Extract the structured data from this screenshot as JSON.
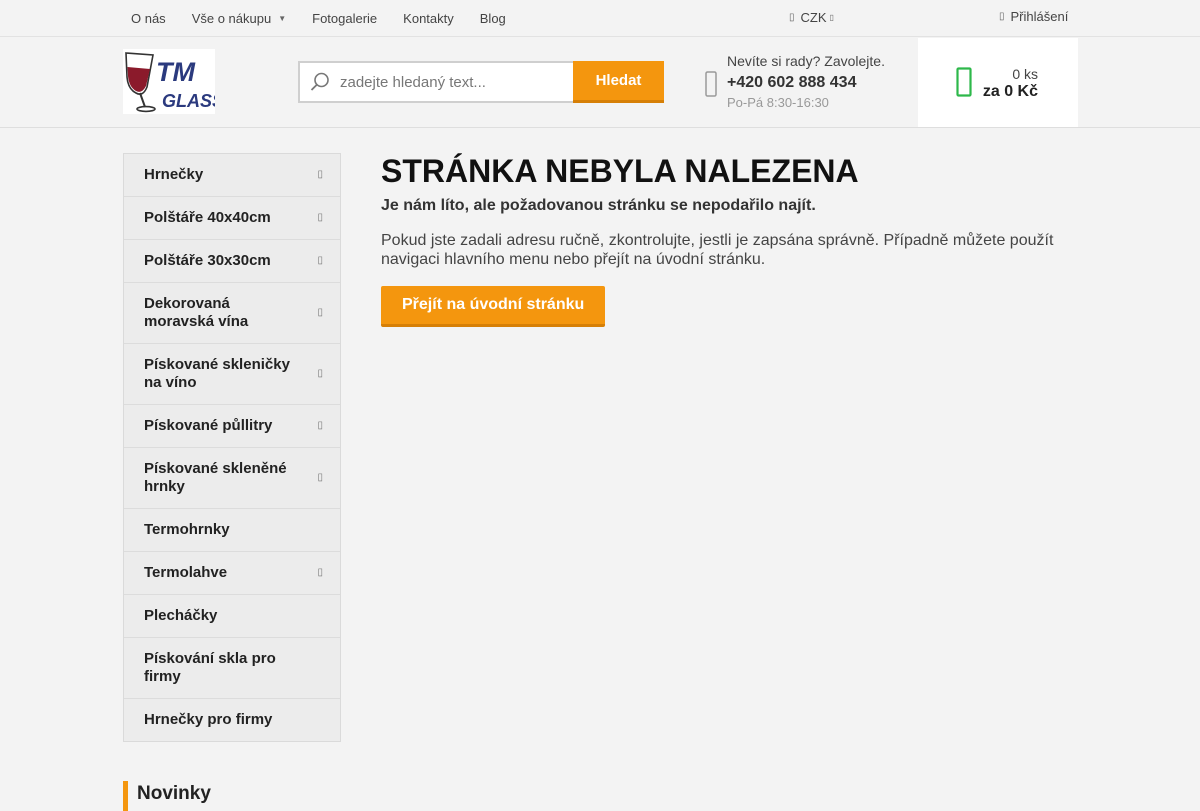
{
  "topnav": {
    "items": [
      {
        "label": "O nás"
      },
      {
        "label": "Vše o nákupu",
        "has_dropdown": true
      },
      {
        "label": "Fotogalerie"
      },
      {
        "label": "Kontakty"
      },
      {
        "label": "Blog"
      }
    ],
    "currency": "CZK",
    "login": "Přihlášení"
  },
  "logo": {
    "text_top": "TM",
    "text_bottom": "GLASS"
  },
  "search": {
    "placeholder": "zadejte hledaný text...",
    "button": "Hledat"
  },
  "contact": {
    "prompt": "Nevíte si rady? Zavolejte.",
    "phone": "+420 602 888 434",
    "hours": "Po-Pá 8:30-16:30"
  },
  "cart": {
    "count": "0 ks",
    "price": "za 0 Kč"
  },
  "sidebar": {
    "categories": [
      {
        "label": "Hrnečky",
        "has_submenu": true
      },
      {
        "label": "Polštáře 40x40cm",
        "has_submenu": true
      },
      {
        "label": "Polštáře 30x30cm",
        "has_submenu": true
      },
      {
        "label": "Dekorovaná moravská vína",
        "has_submenu": true
      },
      {
        "label": "Pískované skleničky na víno",
        "has_submenu": true
      },
      {
        "label": "Pískované půllitry",
        "has_submenu": true
      },
      {
        "label": "Pískované skleněné hrnky",
        "has_submenu": true
      },
      {
        "label": "Termohrnky",
        "has_submenu": false
      },
      {
        "label": "Termolahve",
        "has_submenu": true
      },
      {
        "label": "Plecháčky",
        "has_submenu": false
      },
      {
        "label": "Pískování skla pro firmy",
        "has_submenu": false
      },
      {
        "label": "Hrnečky pro firmy",
        "has_submenu": false
      }
    ],
    "news_heading": "Novinky"
  },
  "main": {
    "title": "STRÁNKA NEBYLA NALEZENA",
    "lead": "Je nám líto, ale požadovanou stránku se nepodařilo najít.",
    "text": "Pokud jste zadali adresu ručně, zkontrolujte, jestli je zapsána správně. Případně můžete použít navigaci hlavního menu nebo přejít na úvodní stránku.",
    "button": "Přejít na úvodní stránku"
  },
  "colors": {
    "accent": "#f4960e",
    "accent_dark": "#d67f06",
    "cart_icon": "#2db84a",
    "logo_blue": "#2b3a7e",
    "wine_red": "#8b1a2b"
  }
}
